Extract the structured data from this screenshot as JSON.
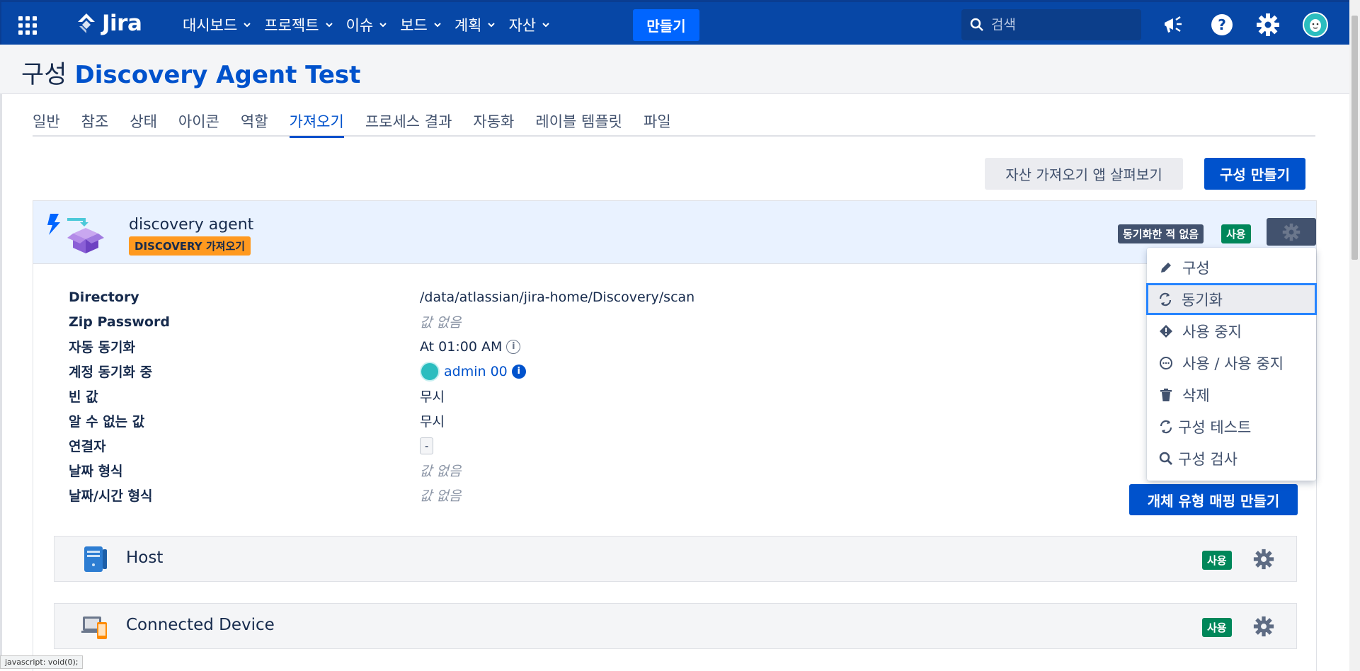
{
  "topnav": {
    "logo_text": "Jira",
    "items": [
      {
        "label": "대시보드"
      },
      {
        "label": "프로젝트"
      },
      {
        "label": "이슈"
      },
      {
        "label": "보드"
      },
      {
        "label": "계획"
      },
      {
        "label": "자산"
      }
    ],
    "create_label": "만들기",
    "search_placeholder": "검색",
    "icons": [
      "megaphone-icon",
      "help-icon",
      "settings-icon",
      "user-avatar"
    ]
  },
  "page": {
    "title_prefix": "구성",
    "title_name": "Discovery Agent Test"
  },
  "tabs": [
    "일반",
    "참조",
    "상태",
    "아이콘",
    "역할",
    "가져오기",
    "프로세스 결과",
    "자동화",
    "레이블 템플릿",
    "파일"
  ],
  "active_tab": "가져오기",
  "actions": {
    "browse_label": "자산 가져오기 앱 살펴보기",
    "create_config_label": "구성 만들기"
  },
  "config": {
    "name": "discovery agent",
    "type_badge": "DISCOVERY 가져오기",
    "sync_status": "동기화한 적 없음",
    "enabled_badge": "사용",
    "details": [
      {
        "label": "Directory",
        "value": "/data/atlassian/jira-home/Discovery/scan"
      },
      {
        "label": "Zip Password",
        "value": "값 없음"
      },
      {
        "label": "자동 동기화",
        "value": "At 01:00 AM"
      },
      {
        "label": "계정 동기화 중",
        "value": "admin 00"
      },
      {
        "label": "빈 값",
        "value": "무시"
      },
      {
        "label": "알 수 없는 값",
        "value": "무시"
      },
      {
        "label": "연결자",
        "value": "-"
      },
      {
        "label": "날짜 형식",
        "value": "값 없음"
      },
      {
        "label": "날짜/시간 형식",
        "value": "값 없음"
      }
    ],
    "mapping_button_label": "개체 유형 매핑 만들기",
    "object_types": [
      {
        "name": "Host",
        "badge": "사용"
      },
      {
        "name": "Connected Device",
        "badge": "사용"
      }
    ]
  },
  "dropdown": {
    "items": [
      {
        "label": "구성",
        "icon": "pencil-icon"
      },
      {
        "label": "동기화",
        "icon": "sync-icon"
      },
      {
        "label": "사용 중지",
        "icon": "warning-icon"
      },
      {
        "label": "사용 / 사용 중지",
        "icon": "ellipsis-circle-icon"
      },
      {
        "label": "삭제",
        "icon": "trash-icon"
      },
      {
        "label": "구성 테스트",
        "icon": "sync-icon"
      },
      {
        "label": "구성 검사",
        "icon": "search-icon"
      }
    ],
    "focused_index": 1
  },
  "statusbar_text": "javascript: void(0);",
  "colors": {
    "nav_bg": "#0747a6",
    "primary": "#0052cc",
    "create_button": "#0065ff",
    "success": "#00875a",
    "warning_badge": "#ff991f"
  }
}
